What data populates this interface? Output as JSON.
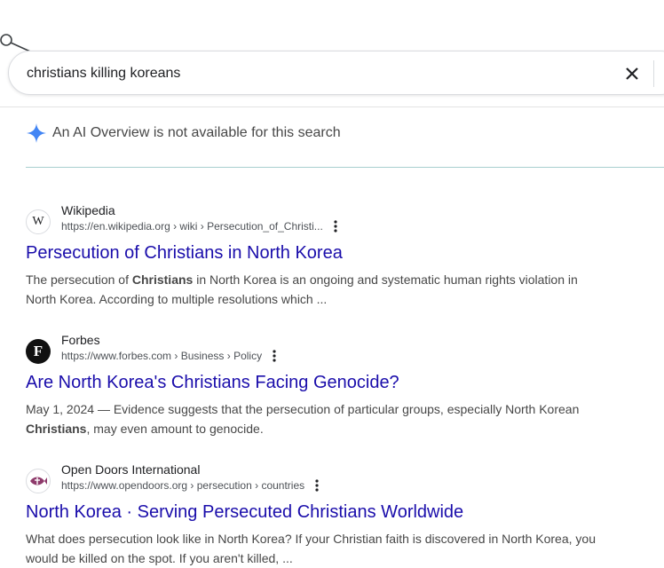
{
  "search": {
    "query": "christians killing koreans"
  },
  "ai_overview": {
    "text": "An AI Overview is not available for this search"
  },
  "results": [
    {
      "site_name": "Wikipedia",
      "url": "https://en.wikipedia.org › wiki › Persecution_of_Christi...",
      "favicon_text": "W",
      "title": "Persecution of Christians in North Korea",
      "snippet_parts": [
        "The persecution of ",
        "Christians",
        " in North Korea is an ongoing and systematic human rights violation in North Korea. According to multiple resolutions which ..."
      ]
    },
    {
      "site_name": "Forbes",
      "url": "https://www.forbes.com › Business › Policy",
      "favicon_text": "F",
      "title": "Are North Korea's Christians Facing Genocide?",
      "snippet_parts": [
        "May 1, 2024 — Evidence suggests that the persecution of particular groups, especially North Korean ",
        "Christians",
        ", may even amount to genocide."
      ]
    },
    {
      "site_name": "Open Doors International",
      "url": "https://www.opendoors.org › persecution › countries",
      "title": "North Korea · Serving Persecuted Christians Worldwide",
      "snippet_parts": [
        "What does persecution look like in North Korea? If your Christian faith is discovered in North Korea, you would be killed on the spot. If you aren't killed, ..."
      ]
    }
  ],
  "colors": {
    "link": "#1a0dab",
    "ai_accent": "#4285f4",
    "rule": "#a8d0cf"
  }
}
